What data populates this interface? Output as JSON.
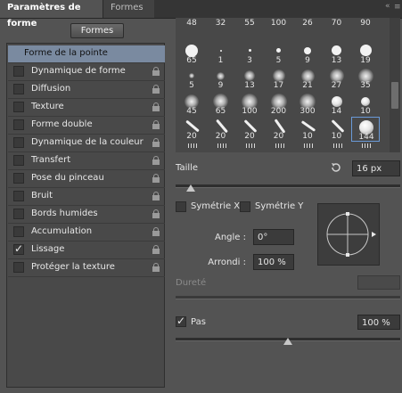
{
  "tabs": {
    "active": "Paramètres de forme",
    "inactive": "Formes",
    "menu": "≡"
  },
  "formes_button": "Formes",
  "options": [
    {
      "label": "Forme de la pointe",
      "checkbox": false,
      "selected": true,
      "lock": false
    },
    {
      "label": "Dynamique de forme",
      "checkbox": true,
      "checked": false,
      "lock": true
    },
    {
      "label": "Diffusion",
      "checkbox": true,
      "checked": false,
      "lock": true
    },
    {
      "label": "Texture",
      "checkbox": true,
      "checked": false,
      "lock": true
    },
    {
      "label": "Forme double",
      "checkbox": true,
      "checked": false,
      "lock": true
    },
    {
      "label": "Dynamique de la couleur",
      "checkbox": true,
      "checked": false,
      "lock": true
    },
    {
      "label": "Transfert",
      "checkbox": true,
      "checked": false,
      "lock": true
    },
    {
      "label": "Pose du pinceau",
      "checkbox": true,
      "checked": false,
      "lock": true
    },
    {
      "label": "Bruit",
      "checkbox": true,
      "checked": false,
      "lock": true
    },
    {
      "label": "Bords humides",
      "checkbox": true,
      "checked": false,
      "lock": true
    },
    {
      "label": "Accumulation",
      "checkbox": true,
      "checked": false,
      "lock": true
    },
    {
      "label": "Lissage",
      "checkbox": true,
      "checked": true,
      "lock": true
    },
    {
      "label": "Protéger la texture",
      "checkbox": true,
      "checked": false,
      "lock": true
    }
  ],
  "brush_rows": [
    [
      {
        "n": "48",
        "t": "dot",
        "s": 3
      },
      {
        "n": "32",
        "t": "dot",
        "s": 3
      },
      {
        "n": "55",
        "t": "dot",
        "s": 3
      },
      {
        "n": "100",
        "t": "dot",
        "s": 3
      },
      {
        "n": "26",
        "t": "dot",
        "s": 3
      },
      {
        "n": "70",
        "t": "dot",
        "s": 3
      },
      {
        "n": "90",
        "t": "dot",
        "s": 3
      }
    ],
    [
      {
        "n": "65",
        "t": "dot",
        "s": 14
      },
      {
        "n": "1",
        "t": "dot",
        "s": 2
      },
      {
        "n": "3",
        "t": "dot",
        "s": 3
      },
      {
        "n": "5",
        "t": "dot",
        "s": 5
      },
      {
        "n": "9",
        "t": "dot",
        "s": 8
      },
      {
        "n": "13",
        "t": "dot",
        "s": 11
      },
      {
        "n": "19",
        "t": "dot",
        "s": 13
      }
    ],
    [
      {
        "n": "5",
        "t": "soft",
        "s": 6
      },
      {
        "n": "9",
        "t": "soft",
        "s": 9
      },
      {
        "n": "13",
        "t": "soft",
        "s": 12
      },
      {
        "n": "17",
        "t": "soft",
        "s": 14
      },
      {
        "n": "21",
        "t": "soft",
        "s": 15
      },
      {
        "n": "27",
        "t": "soft",
        "s": 16
      },
      {
        "n": "35",
        "t": "soft",
        "s": 17
      }
    ],
    [
      {
        "n": "45",
        "t": "soft",
        "s": 16
      },
      {
        "n": "65",
        "t": "soft",
        "s": 17
      },
      {
        "n": "100",
        "t": "soft",
        "s": 18
      },
      {
        "n": "200",
        "t": "soft",
        "s": 18
      },
      {
        "n": "300",
        "t": "soft",
        "s": 18
      },
      {
        "n": "14",
        "t": "sphere",
        "s": 12
      },
      {
        "n": "10",
        "t": "sphere",
        "s": 10
      }
    ],
    [
      {
        "n": "20",
        "t": "stroke",
        "a": -40
      },
      {
        "n": "20",
        "t": "stroke",
        "a": -50
      },
      {
        "n": "20",
        "t": "stroke",
        "a": -45
      },
      {
        "n": "20",
        "t": "stroke",
        "a": -55
      },
      {
        "n": "10",
        "t": "stroke",
        "a": -35
      },
      {
        "n": "10",
        "t": "stroke",
        "a": -45
      },
      {
        "n": "144",
        "t": "sphere",
        "s": 16,
        "sel": true
      }
    ],
    [
      {
        "n": "",
        "t": "spatter"
      },
      {
        "n": "",
        "t": "spatter"
      },
      {
        "n": "",
        "t": "spatter"
      },
      {
        "n": "",
        "t": "spatter"
      },
      {
        "n": "",
        "t": "spatter"
      },
      {
        "n": "",
        "t": "spatter"
      },
      {
        "n": "",
        "t": "spatter"
      }
    ]
  ],
  "taille": {
    "label": "Taille",
    "value": "16 px",
    "slider_fraction": 0.08
  },
  "symetrie": {
    "x_label": "Symétrie X",
    "y_label": "Symétrie Y"
  },
  "angle": {
    "label": "Angle :",
    "value": "0°"
  },
  "arrondi": {
    "label": "Arrondi :",
    "value": "100 %"
  },
  "durete": {
    "label": "Dureté"
  },
  "pas": {
    "label": "Pas",
    "checked": true,
    "value": "100 %",
    "slider_fraction": 0.5
  },
  "icons": {
    "reset": "reset-icon",
    "lock": "lock-icon",
    "menu": "panel-menu-icon"
  }
}
